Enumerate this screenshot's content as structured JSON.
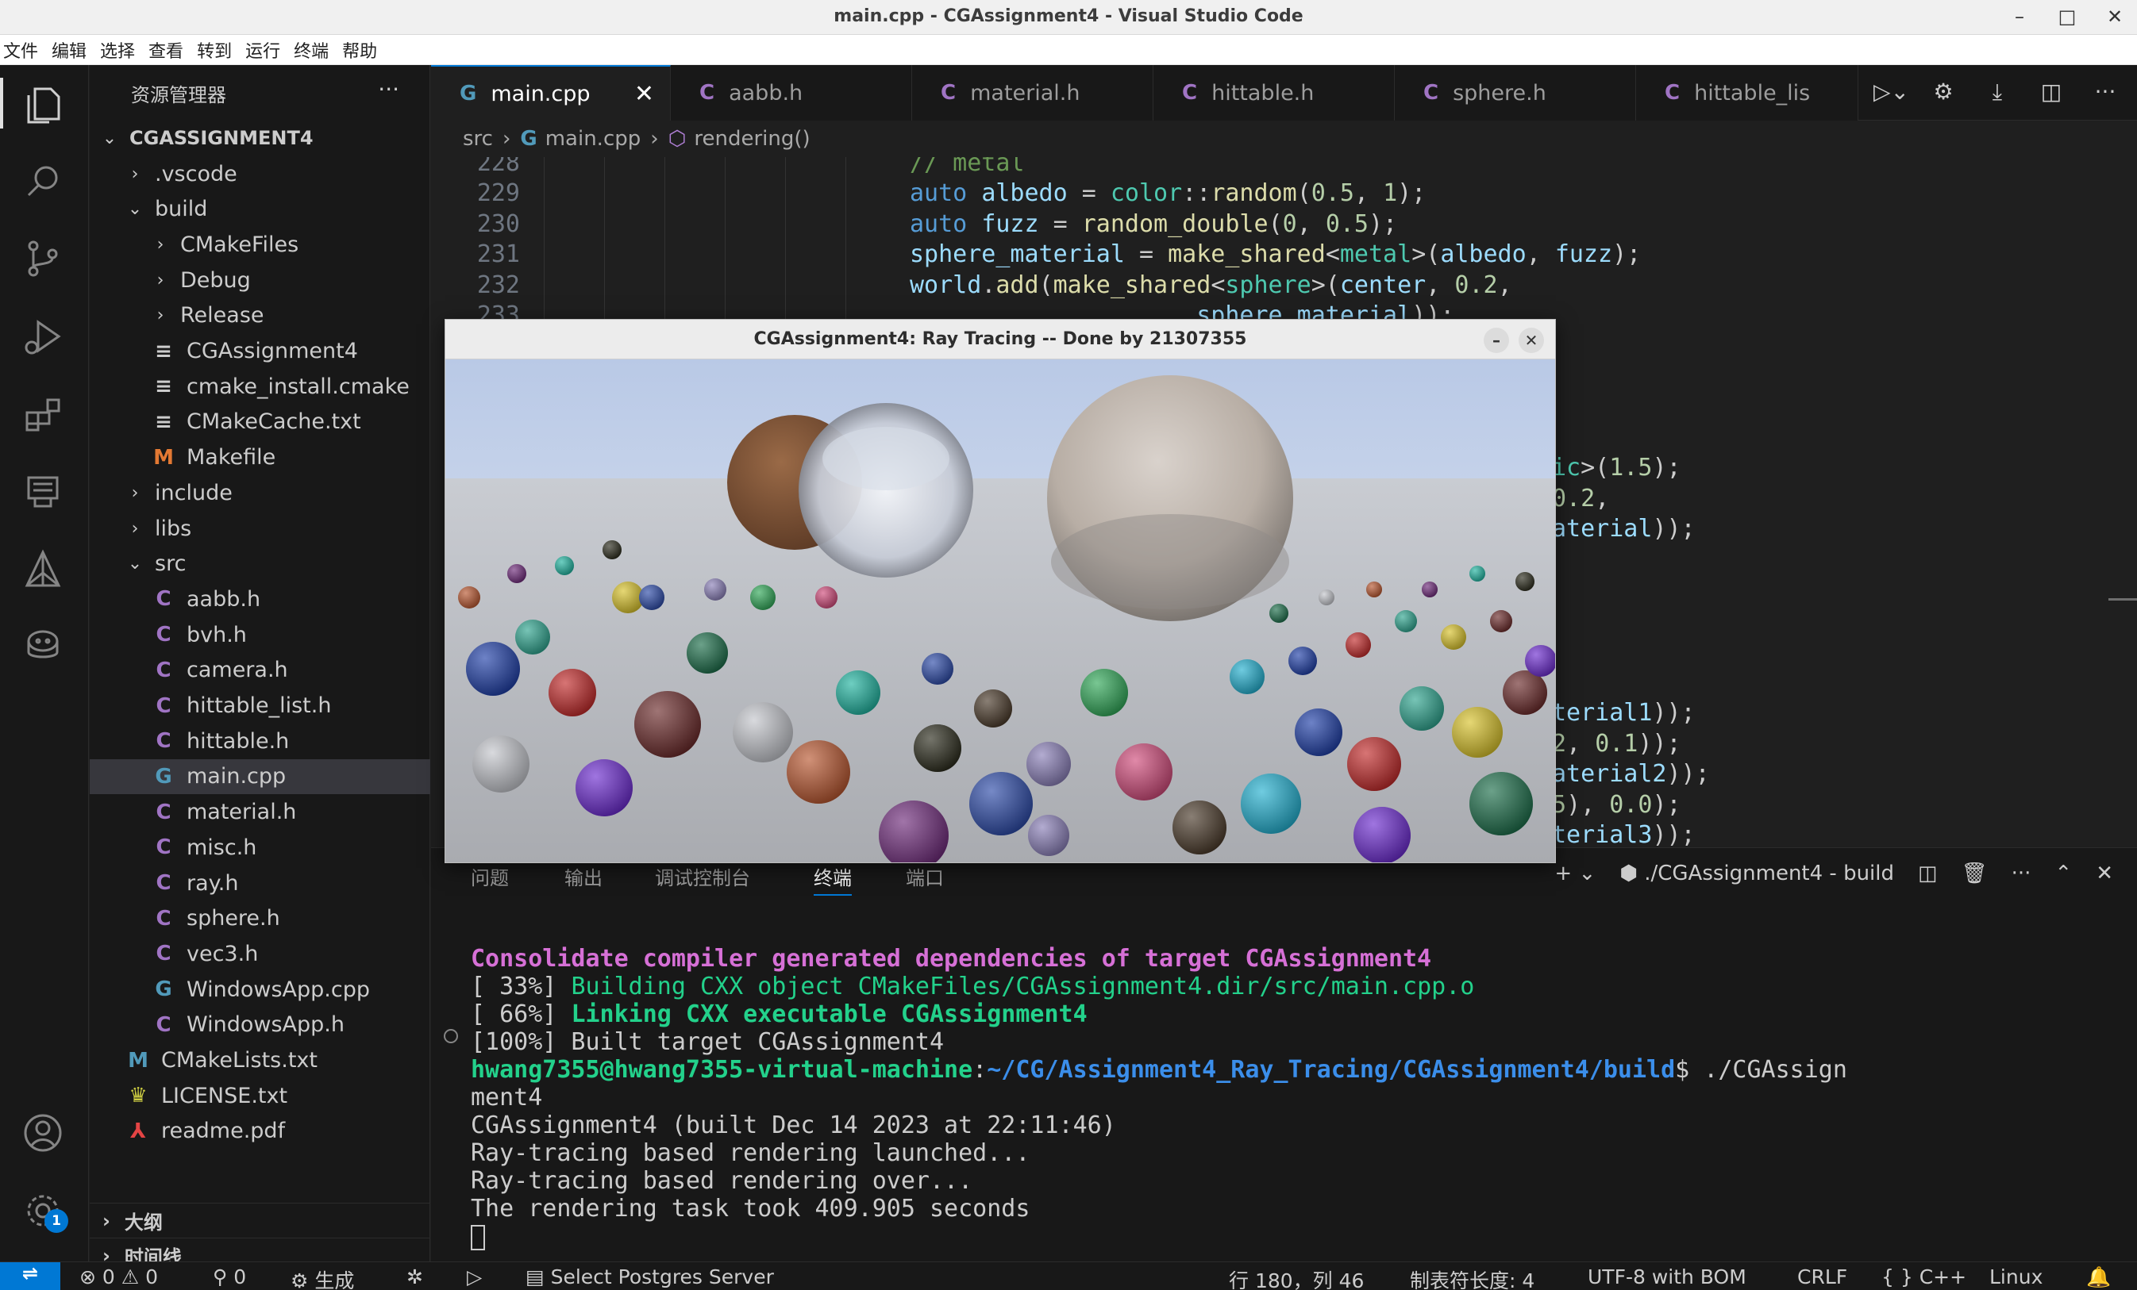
{
  "window": {
    "title": "main.cpp - CGAssignment4 - Visual Studio Code"
  },
  "menu": [
    "文件",
    "编辑",
    "选择",
    "查看",
    "转到",
    "运行",
    "终端",
    "帮助"
  ],
  "sidebar": {
    "header": "资源管理器",
    "more": "···",
    "tree": [
      {
        "label": "CGASSIGNMENT4",
        "depth": 0,
        "type": "root",
        "open": true
      },
      {
        "label": ".vscode",
        "depth": 1,
        "type": "folder",
        "open": false
      },
      {
        "label": "build",
        "depth": 1,
        "type": "folder",
        "open": true
      },
      {
        "label": "CMakeFiles",
        "depth": 2,
        "type": "folder",
        "open": false
      },
      {
        "label": "Debug",
        "depth": 2,
        "type": "folder",
        "open": false
      },
      {
        "label": "Release",
        "depth": 2,
        "type": "folder",
        "open": false
      },
      {
        "label": "CGAssignment4",
        "depth": 2,
        "type": "file",
        "icon": "≡",
        "color": "#cccccc"
      },
      {
        "label": "cmake_install.cmake",
        "depth": 2,
        "type": "file",
        "icon": "≡",
        "color": "#cccccc"
      },
      {
        "label": "CMakeCache.txt",
        "depth": 2,
        "type": "file",
        "icon": "≡",
        "color": "#cccccc"
      },
      {
        "label": "Makefile",
        "depth": 2,
        "type": "file",
        "icon": "M",
        "color": "#e37933"
      },
      {
        "label": "include",
        "depth": 1,
        "type": "folder",
        "open": false
      },
      {
        "label": "libs",
        "depth": 1,
        "type": "folder",
        "open": false
      },
      {
        "label": "src",
        "depth": 1,
        "type": "folder",
        "open": true
      },
      {
        "label": "aabb.h",
        "depth": 2,
        "type": "file",
        "icon": "C",
        "color": "#a074c4"
      },
      {
        "label": "bvh.h",
        "depth": 2,
        "type": "file",
        "icon": "C",
        "color": "#a074c4"
      },
      {
        "label": "camera.h",
        "depth": 2,
        "type": "file",
        "icon": "C",
        "color": "#a074c4"
      },
      {
        "label": "hittable_list.h",
        "depth": 2,
        "type": "file",
        "icon": "C",
        "color": "#a074c4"
      },
      {
        "label": "hittable.h",
        "depth": 2,
        "type": "file",
        "icon": "C",
        "color": "#a074c4"
      },
      {
        "label": "main.cpp",
        "depth": 2,
        "type": "file",
        "icon": "G",
        "color": "#519aba",
        "selected": true
      },
      {
        "label": "material.h",
        "depth": 2,
        "type": "file",
        "icon": "C",
        "color": "#a074c4"
      },
      {
        "label": "misc.h",
        "depth": 2,
        "type": "file",
        "icon": "C",
        "color": "#a074c4"
      },
      {
        "label": "ray.h",
        "depth": 2,
        "type": "file",
        "icon": "C",
        "color": "#a074c4"
      },
      {
        "label": "sphere.h",
        "depth": 2,
        "type": "file",
        "icon": "C",
        "color": "#a074c4"
      },
      {
        "label": "vec3.h",
        "depth": 2,
        "type": "file",
        "icon": "C",
        "color": "#a074c4"
      },
      {
        "label": "WindowsApp.cpp",
        "depth": 2,
        "type": "file",
        "icon": "G",
        "color": "#519aba"
      },
      {
        "label": "WindowsApp.h",
        "depth": 2,
        "type": "file",
        "icon": "C",
        "color": "#a074c4"
      },
      {
        "label": "CMakeLists.txt",
        "depth": 1,
        "type": "file",
        "icon": "M",
        "color": "#519aba"
      },
      {
        "label": "LICENSE.txt",
        "depth": 1,
        "type": "file",
        "icon": "♛",
        "color": "#cbcb41"
      },
      {
        "label": "readme.pdf",
        "depth": 1,
        "type": "file",
        "icon": "⅄",
        "color": "#e44444"
      }
    ],
    "outline": "大纲",
    "timeline": "时间线"
  },
  "tabs": [
    {
      "label": "main.cpp",
      "icon": "G",
      "active": true
    },
    {
      "label": "aabb.h",
      "icon": "C"
    },
    {
      "label": "material.h",
      "icon": "C"
    },
    {
      "label": "hittable.h",
      "icon": "C"
    },
    {
      "label": "sphere.h",
      "icon": "C"
    },
    {
      "label": "hittable_lis",
      "icon": "C"
    }
  ],
  "breadcrumb": {
    "folder": "src",
    "file": "main.cpp",
    "symbol": "rendering()"
  },
  "editor": {
    "lines": [
      {
        "n": "228",
        "html": "<span class='cm'>// metal</span>"
      },
      {
        "n": "229",
        "html": "<span class='kw'>auto</span> <span class='var'>albedo</span> = <span class='ty'>color</span>::<span class='fn'>random</span>(<span class='num'>0.5</span>, <span class='num'>1</span>);"
      },
      {
        "n": "230",
        "html": "<span class='kw'>auto</span> <span class='var'>fuzz</span> = <span class='fn'>random_double</span>(<span class='num'>0</span>, <span class='num'>0.5</span>);"
      },
      {
        "n": "231",
        "html": "<span class='var'>sphere_material</span> = <span class='fn'>make_shared</span>&lt;<span class='ty'>metal</span>&gt;(<span class='var'>albedo</span>, <span class='var'>fuzz</span>);"
      },
      {
        "n": "232",
        "html": "<span class='var'>world</span>.<span class='fn'>add</span>(<span class='fn'>make_shared</span>&lt;<span class='ty'>sphere</span>&gt;(<span class='var'>center</span>, <span class='num'>0.2</span>,"
      },
      {
        "n": "233",
        "html": "                    <span class='var'>sphere_material</span>));"
      }
    ],
    "right_fragments": [
      {
        "html": "<span class='ty'>ic</span>&gt;(<span class='num'>1.5</span>);"
      },
      {
        "html": "<span class='num'>0.2</span>,"
      },
      {
        "html": "<span class='var'>aterial</span>));"
      },
      {
        "html": "<span class='var'>terial1</span>));"
      },
      {
        "html": "<span class='num'>2</span>, <span class='num'>0.1</span>));"
      },
      {
        "html": "<span class='var'>aterial2</span>));"
      },
      {
        "html": "<span class='num'>5</span>), <span class='num'>0.0</span>);"
      },
      {
        "html": "<span class='var'>terial3</span>));"
      }
    ]
  },
  "render_window": {
    "title": "CGAssignment4: Ray Tracing -- Done by 21307355",
    "min": "–",
    "close": "✕"
  },
  "panel": {
    "tabs": [
      "问题",
      "输出",
      "调试控制台",
      "终端",
      "端口"
    ],
    "active_tab": "终端",
    "terminal_name": "./CGAssignment4 - build",
    "terminal": {
      "l1": "Consolidate compiler generated dependencies of target CGAssignment4",
      "l2a": "[ 33%] ",
      "l2b": "Building CXX object CMakeFiles/CGAssignment4.dir/src/main.cpp.o",
      "l3a": "[ 66%] ",
      "l3b": "Linking CXX executable CGAssignment4",
      "l4": "[100%] Built target CGAssignment4",
      "user": "hwang7355@hwang7355-virtual-machine",
      "colon": ":",
      "path": "~/CG/Assignment4_Ray_Tracing/CGAssignment4/build",
      "cmd": "$ ./CGAssign",
      "cmd2": "ment4",
      "o1": "CGAssignment4 (built Dec 14 2023 at 22:11:46)",
      "o2": "Ray-tracing based rendering launched...",
      "o3": "Ray-tracing based rendering over...",
      "o4": "The rendering task took 409.905 seconds"
    }
  },
  "statusbar": {
    "remote": "⇌",
    "errors": "⊗ 0 ⚠ 0",
    "ports": "⚲ 0",
    "build": "⚙ 生成",
    "debug": "✲",
    "run": "▷",
    "postgres": "Select Postgres Server",
    "position": "行 180，列 46",
    "tabsize": "制表符长度: 4",
    "encoding": "UTF-8 with BOM",
    "eol": "CRLF",
    "lang": "{ } C++",
    "os": "Linux",
    "bell": "🔔"
  },
  "activity_badge": "1"
}
